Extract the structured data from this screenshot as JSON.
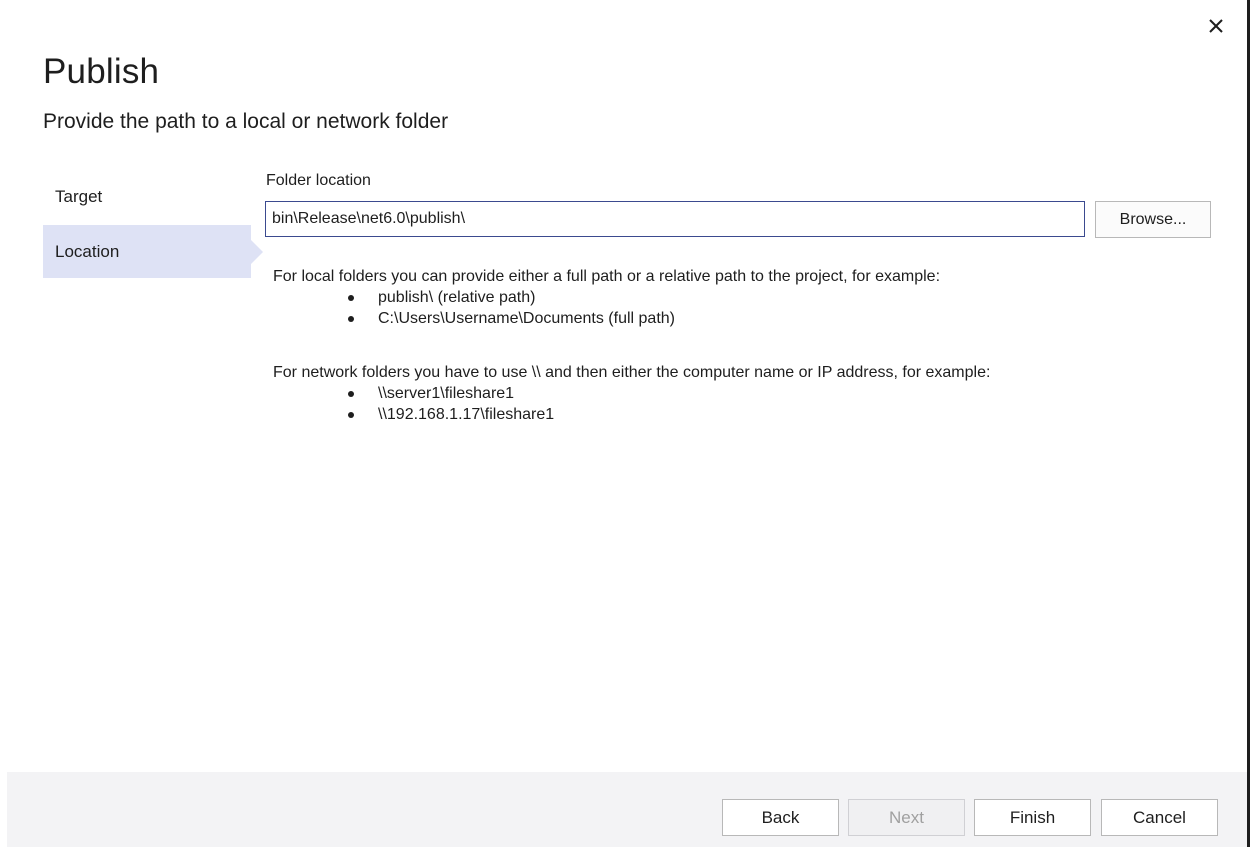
{
  "dialog": {
    "title": "Publish",
    "subtitle": "Provide the path to a local or network folder",
    "close_icon": "close-icon"
  },
  "nav": {
    "items": [
      {
        "label": "Target",
        "selected": false
      },
      {
        "label": "Location",
        "selected": true
      }
    ]
  },
  "location": {
    "field_label": "Folder location",
    "path_value": "bin\\Release\\net6.0\\publish\\",
    "browse_label": "Browse..."
  },
  "help": {
    "local_intro": "For local folders you can provide either a full path or a relative path to the project, for example:",
    "local_examples": [
      "publish\\ (relative path)",
      "C:\\Users\\Username\\Documents (full path)"
    ],
    "network_intro": "For network folders you have to use \\\\ and then either the computer name or IP address, for example:",
    "network_examples": [
      "\\\\server1\\fileshare1",
      "\\\\192.168.1.17\\fileshare1"
    ]
  },
  "footer": {
    "back_label": "Back",
    "next_label": "Next",
    "finish_label": "Finish",
    "cancel_label": "Cancel"
  },
  "colors": {
    "selected_nav_bg": "#dee2f5",
    "input_border": "#3b4a8f",
    "footer_bg": "#f3f3f5"
  }
}
